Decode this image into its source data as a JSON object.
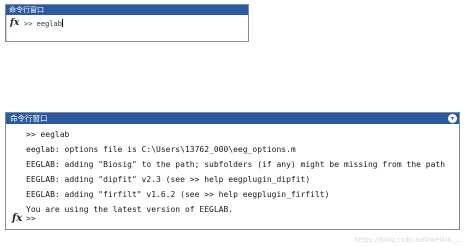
{
  "top_window": {
    "title": "命令行窗口",
    "fx_label": "fx",
    "prompt": ">>",
    "command": "eeglab"
  },
  "bottom_window": {
    "title": "命令行窗口",
    "menu_icon": "chevron-down-icon",
    "lines": [
      ">> eeglab",
      "eeglab: options file is C:\\Users\\13762_000\\eeg_options.m",
      "EEGLAB: adding \"Biosig\" to the path; subfolders (if any) might be missing from the path",
      "EEGLAB: adding \"dipfit\" v2.3 (see >> help eegplugin_dipfit)",
      "EEGLAB: adding \"firfilt\" v1.6.2 (see >> help eegplugin_firfilt)",
      "You are using the latest version of EEGLAB."
    ],
    "fx_label": "fx",
    "prompt": ">>"
  },
  "watermark": "https://blog.csdn.net/weixin_..."
}
